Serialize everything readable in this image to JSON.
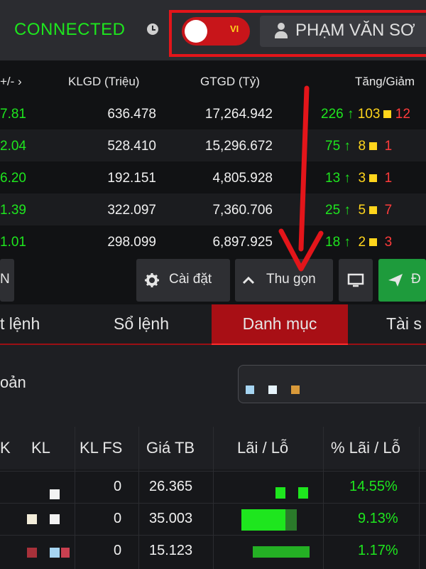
{
  "header": {
    "status": "CONNECTED",
    "language": "VI",
    "user_name": "PHẠM VĂN SƠ"
  },
  "market": {
    "columns": [
      "+/-",
      "KLGD (Triệu)",
      "GTGD (Tỷ)",
      "Tăng/Giảm"
    ],
    "rows": [
      {
        "change": "7.81",
        "volume": "636.478",
        "value": "17,264.942",
        "up": "226",
        "flat": "103",
        "down": "12"
      },
      {
        "change": "2.04",
        "volume": "528.410",
        "value": "15,296.672",
        "up": "75",
        "flat": "8",
        "down": "1"
      },
      {
        "change": "6.20",
        "volume": "192.151",
        "value": "4,805.928",
        "up": "13",
        "flat": "3",
        "down": "1"
      },
      {
        "change": "1.39",
        "volume": "322.097",
        "value": "7,360.706",
        "up": "25",
        "flat": "5",
        "down": "7"
      },
      {
        "change": "1.01",
        "volume": "298.099",
        "value": "6,897.925",
        "up": "18",
        "flat": "2",
        "down": "3"
      }
    ]
  },
  "toolbar": {
    "left_label": "N",
    "settings_label": "Cài đặt",
    "collapse_label": "Thu gọn",
    "order_label": "Đ"
  },
  "tabs": [
    {
      "label": "t lệnh"
    },
    {
      "label": "Sổ lệnh"
    },
    {
      "label": "Danh mục"
    },
    {
      "label": "Tài s"
    }
  ],
  "account": {
    "label": "oản"
  },
  "portfolio": {
    "columns": [
      "K",
      "KL",
      "KL FS",
      "Giá TB",
      "Lãi / Lỗ",
      "% Lãi / Lỗ"
    ],
    "rows": [
      {
        "kl_fs": "0",
        "avg_price": "26.365",
        "pct": "14.55%"
      },
      {
        "kl_fs": "0",
        "avg_price": "35.003",
        "pct": "9.13%"
      },
      {
        "kl_fs": "0",
        "avg_price": "15.123",
        "pct": "1.17%"
      }
    ]
  },
  "colors": {
    "accent_red": "#e3151a",
    "up_green": "#1ee61e",
    "flat_yellow": "#ffd51c"
  }
}
